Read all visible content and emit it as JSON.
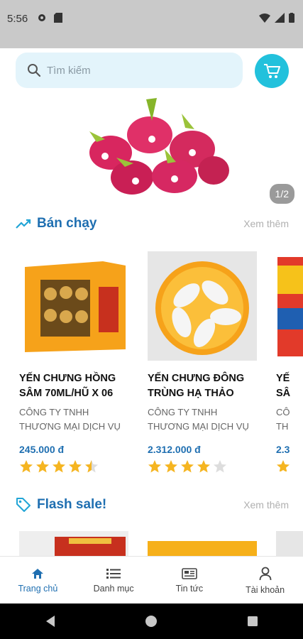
{
  "status_bar": {
    "time": "5:56",
    "icons": [
      "settings-icon",
      "sim-card-icon",
      "wifi-icon",
      "signal-icon",
      "battery-icon"
    ]
  },
  "search": {
    "placeholder": "Tìm kiếm"
  },
  "banner": {
    "indicator": "1/2"
  },
  "best_sellers": {
    "title": "Bán chạy",
    "see_more": "Xem thêm",
    "products": [
      {
        "name": "YẾN CHƯNG HỒNG SÂM 70ML/HŨ X 06",
        "company": "CÔNG TY TNHH THƯƠNG MẠI DỊCH VỤ",
        "price": "245.000 đ",
        "rating": 4.5
      },
      {
        "name": "YẾN CHƯNG ĐÔNG TRÙNG HẠ THẢO",
        "company": "CÔNG TY TNHH THƯƠNG MẠI DỊCH VỤ",
        "price": "2.312.000 đ",
        "rating": 4
      },
      {
        "name": "YẾ SÂ",
        "company": "CÔ TH",
        "price": "2.3",
        "rating": 1
      }
    ]
  },
  "flash_sale": {
    "title": "Flash sale!",
    "see_more": "Xem thêm"
  },
  "bottom_nav": {
    "items": [
      {
        "label": "Trang chủ",
        "icon": "home-icon",
        "active": true
      },
      {
        "label": "Danh mục",
        "icon": "list-icon",
        "active": false
      },
      {
        "label": "Tin tức",
        "icon": "news-icon",
        "active": false
      },
      {
        "label": "Tài khoản",
        "icon": "account-icon",
        "active": false
      }
    ]
  },
  "colors": {
    "accent": "#1f6fb1",
    "cart": "#22c1dc",
    "star": "#f5b521",
    "search_bg": "#e3f4fb"
  }
}
